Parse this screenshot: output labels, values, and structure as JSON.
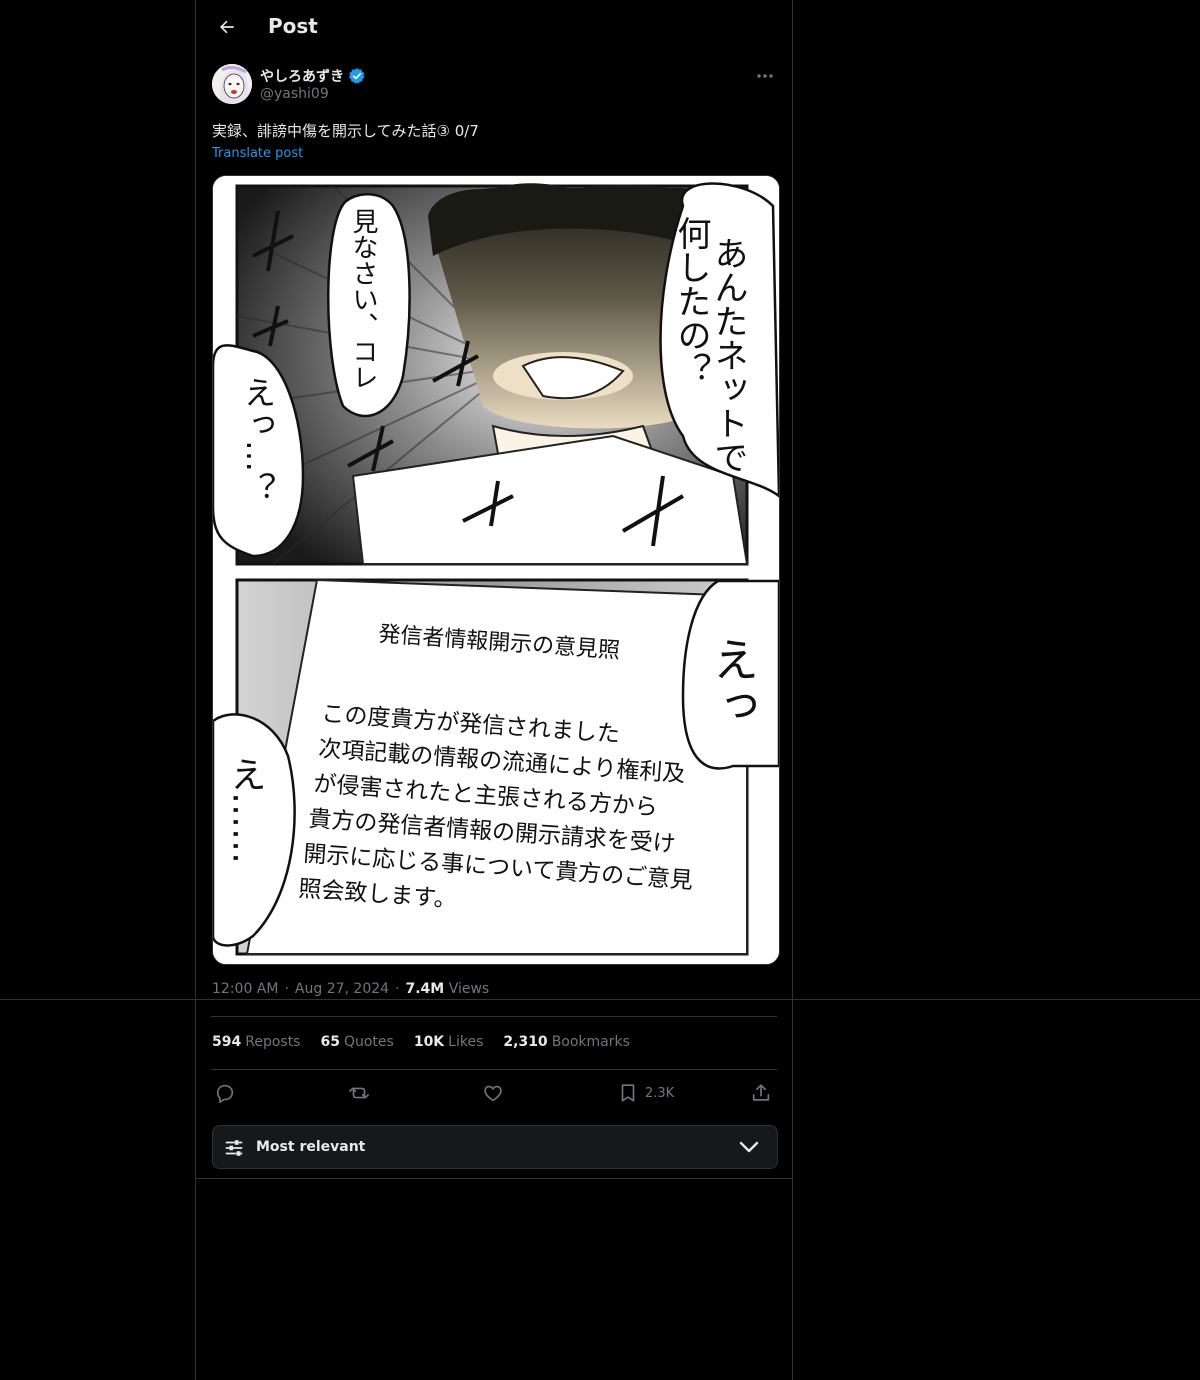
{
  "header": {
    "title": "Post"
  },
  "post": {
    "display_name": "やしろあずき",
    "handle": "@yashi09",
    "text": "実録、誹謗中傷を開示してみた話③ 0/7",
    "translate_label": "Translate post",
    "time": "12:00 AM",
    "date": "Aug 27, 2024",
    "views_count": "7.4M",
    "views_label": "Views",
    "separator": "·"
  },
  "comic": {
    "top_panel": {
      "bubble_mother": "あんたネットで何したの？",
      "bubble_show": "見なさい、コレ",
      "bubble_eh": "えっ…？"
    },
    "bottom_panel": {
      "document_title": "発信者情報開示の意見照",
      "document_body": [
        "この度貴方が発信されました",
        "次項記載の情報の流通により権利及",
        "が侵害されたと主張される方から",
        "貴方の発信者情報の開示請求を受け",
        "開示に応じる事について貴方のご意見",
        "照会致します。"
      ],
      "bubble_right": "えっ",
      "bubble_left": "え……"
    }
  },
  "stats": [
    {
      "count": "594",
      "label": "Reposts"
    },
    {
      "count": "65",
      "label": "Quotes"
    },
    {
      "count": "10K",
      "label": "Likes"
    },
    {
      "count": "2,310",
      "label": "Bookmarks"
    }
  ],
  "actions": {
    "bookmark_count": "2.3K"
  },
  "sort": {
    "label": "Most relevant"
  },
  "colors": {
    "accent": "#1d9bf0",
    "muted": "#71767b",
    "text": "#e7e9ea",
    "border": "#2f3336"
  },
  "icons": [
    "back-arrow-icon",
    "verified-badge-icon",
    "more-icon",
    "reply-icon",
    "repost-icon",
    "like-icon",
    "bookmark-icon",
    "share-icon",
    "sliders-icon",
    "chevron-down-icon"
  ]
}
